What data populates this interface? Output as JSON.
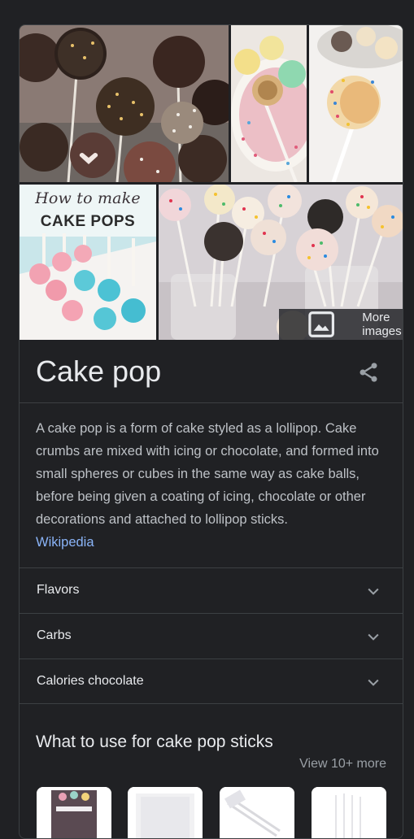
{
  "knowledge_panel": {
    "image_overlay": {
      "more_images_label": "More images",
      "tile4_heading_script": "How to make",
      "tile4_heading_bold": "CAKE POPS"
    },
    "title": "Cake pop",
    "description": "A cake pop is a form of cake styled as a lollipop. Cake crumbs are mixed with icing or chocolate, and formed into small spheres or cubes in the same way as cake balls, before being given a coating of icing, chocolate or other decorations and attached to lollipop sticks.",
    "source_link": "Wikipedia",
    "accordions": [
      {
        "label": "Flavors"
      },
      {
        "label": "Carbs"
      },
      {
        "label": "Calories chocolate"
      }
    ],
    "section": {
      "title": "What to use for cake pop sticks",
      "view_more": "View 10+ more"
    }
  },
  "icons": {
    "more_images": "image-icon",
    "share": "share-icon",
    "accordion": "chevron-down-icon"
  },
  "colors": {
    "background": "#202124",
    "border": "#3c4043",
    "text_primary": "#e8eaed",
    "text_secondary": "#bdc1c6",
    "link": "#8ab4f8",
    "muted": "#9aa0a6"
  }
}
